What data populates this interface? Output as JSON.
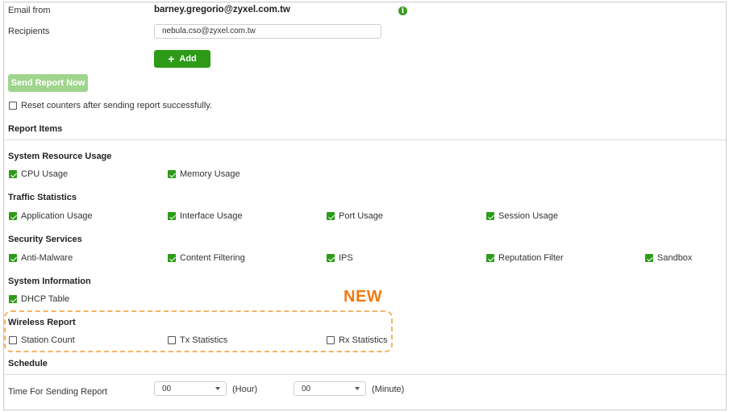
{
  "email": {
    "from_label": "Email from",
    "from_value": "barney.gregorio@zyxel.com.tw",
    "info_icon": "info-icon",
    "recipients_label": "Recipients",
    "recipients_value": "nebula.cso@zyxel.com.tw",
    "add_label": "Add",
    "add_icon": "+"
  },
  "send_report_label": "Send Report Now",
  "reset_counters": {
    "label": "Reset counters after sending report successfully.",
    "checked": false
  },
  "report_items_title": "Report Items",
  "groups": {
    "system_resource": {
      "title": "System Resource Usage",
      "items": [
        {
          "label": "CPU Usage",
          "checked": true
        },
        {
          "label": "Memory Usage",
          "checked": true
        }
      ]
    },
    "traffic": {
      "title": "Traffic Statistics",
      "items": [
        {
          "label": "Application Usage",
          "checked": true
        },
        {
          "label": "Interface Usage",
          "checked": true
        },
        {
          "label": "Port Usage",
          "checked": true
        },
        {
          "label": "Session Usage",
          "checked": true
        }
      ]
    },
    "security": {
      "title": "Security Services",
      "items": [
        {
          "label": "Anti-Malware",
          "checked": true
        },
        {
          "label": "Content Filtering",
          "checked": true
        },
        {
          "label": "IPS",
          "checked": true
        },
        {
          "label": "Reputation Filter",
          "checked": true
        },
        {
          "label": "Sandbox",
          "checked": true
        }
      ]
    },
    "system_info": {
      "title": "System Information",
      "items": [
        {
          "label": "DHCP Table",
          "checked": true
        }
      ]
    },
    "wireless": {
      "title": "Wireless Report",
      "badge": "NEW",
      "items": [
        {
          "label": "Station Count",
          "checked": false
        },
        {
          "label": "Tx Statistics",
          "checked": false
        },
        {
          "label": "Rx Statistics",
          "checked": false
        }
      ]
    }
  },
  "schedule": {
    "title": "Schedule",
    "time_label": "Time For Sending Report",
    "hour_value": "00",
    "hour_unit": "(Hour)",
    "minute_value": "00",
    "minute_unit": "(Minute)"
  },
  "colors": {
    "accent": "#2d9b18",
    "accent_disabled": "#9fd58d",
    "highlight": "#f07a12",
    "highlight_border": "#f3b463"
  }
}
